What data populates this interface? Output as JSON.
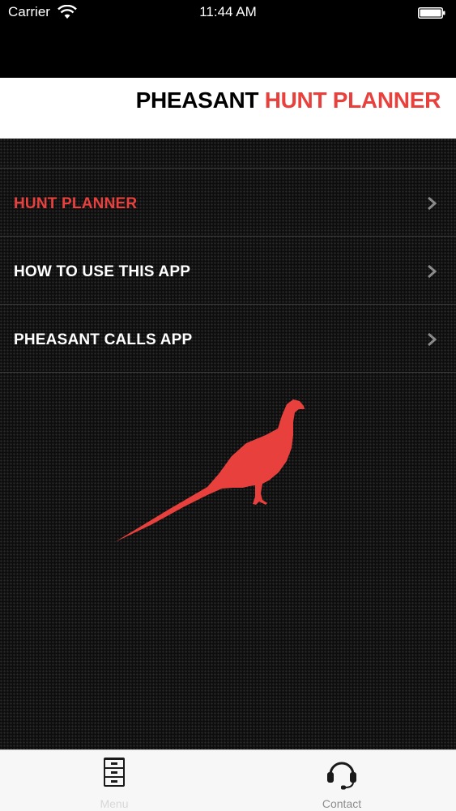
{
  "status_bar": {
    "carrier": "Carrier",
    "time": "11:44 AM",
    "wifi_icon": "wifi-icon",
    "battery_icon": "battery-icon"
  },
  "header": {
    "title_part1": "PHEASANT",
    "title_part2": "HUNT PLANNER"
  },
  "menu": {
    "items": [
      {
        "label": "HUNT PLANNER",
        "active": true
      },
      {
        "label": "HOW TO USE THIS APP",
        "active": false
      },
      {
        "label": "PHEASANT CALLS APP",
        "active": false
      }
    ]
  },
  "illustration": "pheasant-silhouette",
  "tab_bar": {
    "tabs": [
      {
        "label": "Menu",
        "icon": "file-cabinet-icon",
        "selected": true
      },
      {
        "label": "Contact",
        "icon": "headset-icon",
        "selected": false
      }
    ]
  },
  "colors": {
    "accent": "#e8413d",
    "background": "#0d0d0d",
    "header_bg": "#ffffff",
    "tab_bar_bg": "#f7f7f7"
  }
}
